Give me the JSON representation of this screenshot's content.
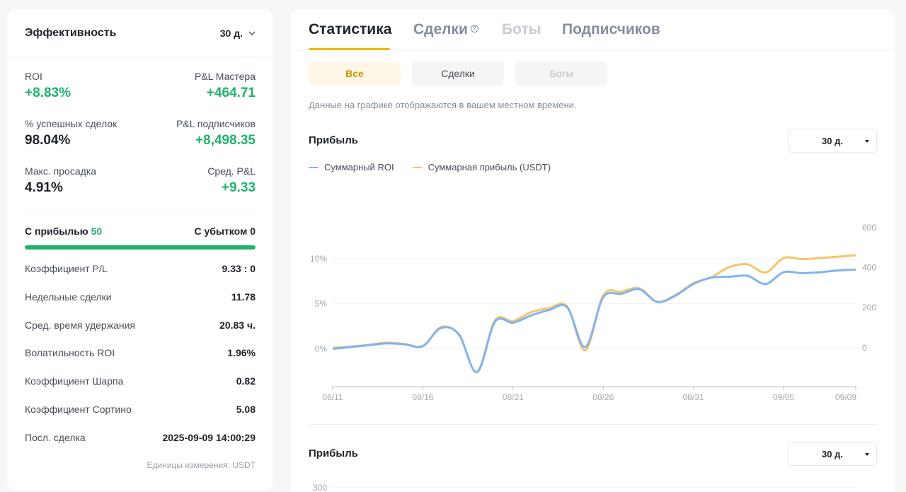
{
  "performance": {
    "title": "Эффективность",
    "period": "30 д.",
    "metrics": {
      "roi_label": "ROI",
      "roi_value": "+8.83%",
      "master_pnl_label": "P&L Мастера",
      "master_pnl_value": "+464.71",
      "win_rate_label": "% успешных сделок",
      "win_rate_value": "98.04%",
      "subs_pnl_label": "P&L подписчиков",
      "subs_pnl_value": "+8,498.35",
      "mdd_label": "Макс. просадка",
      "mdd_value": "4.91%",
      "avg_pnl_label": "Сред. P&L",
      "avg_pnl_value": "+9.33"
    },
    "win_label": "С прибылью",
    "win_count": "50",
    "loss_label": "С убытком",
    "loss_count": "0",
    "win_ratio": 1.0,
    "rows": [
      {
        "label": "Коэффициент P/L",
        "value": "9.33 : 0"
      },
      {
        "label": "Недельные сделки",
        "value": "11.78"
      },
      {
        "label": "Сред. время удержания",
        "value": "20.83 ч."
      },
      {
        "label": "Волатильность ROI",
        "value": "1.96%"
      },
      {
        "label": "Коэффициент Шарпа",
        "value": "0.82"
      },
      {
        "label": "Коэффициент Сортино",
        "value": "5.08"
      },
      {
        "label": "Посл. сделка",
        "value": "2025-09-09 14:00:29"
      }
    ],
    "units": "Единицы измерения: USDT"
  },
  "tabs": [
    "Статистика",
    "Сделки",
    "Боты",
    "Подписчиков"
  ],
  "filters": [
    "Все",
    "Сделки",
    "Боты"
  ],
  "note": "Данные на графике отображаются в вашем местном времени.",
  "section1": {
    "title": "Прибыль",
    "period": "30 д."
  },
  "section2": {
    "title": "Прибыль",
    "period": "30 д.",
    "y_tick_visible": "300"
  },
  "colors": {
    "roi": "#82b4f0",
    "profit": "#f6c46b",
    "green": "#20b26c",
    "accent": "#f0b90b"
  },
  "chart_data": {
    "type": "line",
    "title": "Прибыль",
    "x_ticks": [
      "08/11",
      "08/16",
      "08/21",
      "08/26",
      "08/31",
      "09/05",
      "09/09"
    ],
    "y_left": {
      "ticks": [
        "0%",
        "5%",
        "10%"
      ],
      "range": [
        -4.2,
        14
      ]
    },
    "y_right": {
      "ticks": [
        "0",
        "200",
        "400",
        "600"
      ],
      "range": [
        -195,
        625
      ]
    },
    "legend_position": "top-left",
    "grid": true,
    "series": [
      {
        "name": "Суммарный ROI",
        "axis": "left",
        "x": [
          "08/11",
          "08/12",
          "08/13",
          "08/14",
          "08/15",
          "08/16",
          "08/17",
          "08/18",
          "08/19",
          "08/20",
          "08/21",
          "08/22",
          "08/23",
          "08/24",
          "08/25",
          "08/26",
          "08/27",
          "08/28",
          "08/29",
          "08/30",
          "08/31",
          "09/01",
          "09/02",
          "09/03",
          "09/04",
          "09/05",
          "09/06",
          "09/07",
          "09/08",
          "09/09"
        ],
        "values": [
          0.0,
          0.2,
          0.4,
          0.6,
          0.5,
          0.3,
          2.3,
          1.6,
          -2.6,
          3.0,
          2.9,
          3.7,
          4.3,
          4.6,
          0.2,
          5.7,
          6.1,
          6.6,
          5.2,
          5.9,
          7.2,
          7.9,
          8.0,
          8.1,
          7.2,
          8.5,
          8.4,
          8.5,
          8.7,
          8.8
        ]
      },
      {
        "name": "Суммарная прибыль (USDT)",
        "axis": "right",
        "x": [
          "08/11",
          "08/12",
          "08/13",
          "08/14",
          "08/15",
          "08/16",
          "08/17",
          "08/18",
          "08/19",
          "08/20",
          "08/21",
          "08/22",
          "08/23",
          "08/24",
          "08/25",
          "08/26",
          "08/27",
          "08/28",
          "08/29",
          "08/30",
          "08/31",
          "09/01",
          "09/02",
          "09/03",
          "09/04",
          "09/05",
          "09/06",
          "09/07",
          "09/08",
          "09/09"
        ],
        "values": [
          -1,
          6,
          14,
          25,
          18,
          8,
          103,
          65,
          -120,
          137,
          133,
          177,
          198,
          206,
          -13,
          262,
          279,
          297,
          229,
          263,
          322,
          353,
          403,
          417,
          376,
          448,
          443,
          448,
          455,
          462
        ]
      }
    ]
  }
}
